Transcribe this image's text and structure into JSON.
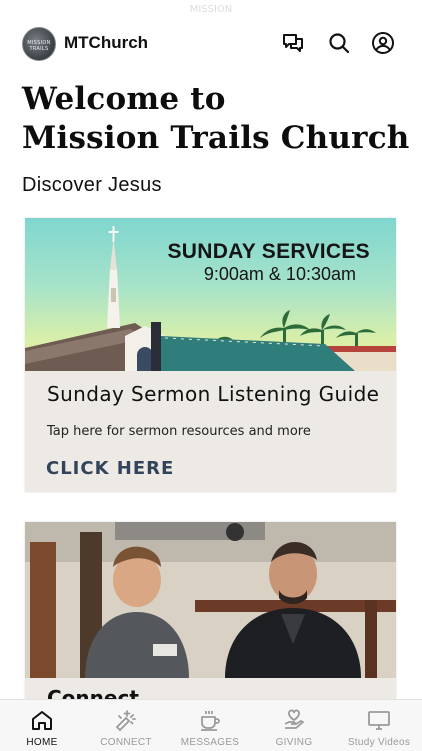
{
  "status": {
    "carrier": "MISSION"
  },
  "header": {
    "logo_text": "MISSION TRAILS",
    "app_name": "MTChurch",
    "icons": [
      "chat-icon",
      "search-icon",
      "profile-icon"
    ]
  },
  "hero": {
    "title_line1": "Welcome to",
    "title_line2": "Mission Trails Church",
    "subtitle": "Discover Jesus"
  },
  "cards": [
    {
      "banner_title": "SUNDAY SERVICES",
      "banner_time": "9:00am & 10:30am",
      "heading": "Sunday Sermon Listening Guide",
      "text": "Tap here for sermon resources and more",
      "link": "CLICK HERE"
    },
    {
      "heading": "Connect"
    }
  ],
  "tabs": [
    {
      "label": "HOME",
      "icon": "home-icon",
      "active": true
    },
    {
      "label": "CONNECT",
      "icon": "sparkle-icon",
      "active": false
    },
    {
      "label": "MESSAGES",
      "icon": "coffee-cup-icon",
      "active": false
    },
    {
      "label": "GIVING",
      "icon": "heart-hand-icon",
      "active": false
    },
    {
      "label": "Study Videos",
      "icon": "monitor-icon",
      "active": false
    }
  ],
  "colors": {
    "card_bg": "#edeae6",
    "link": "#33445a",
    "tab_inactive": "#9a9a9a"
  }
}
